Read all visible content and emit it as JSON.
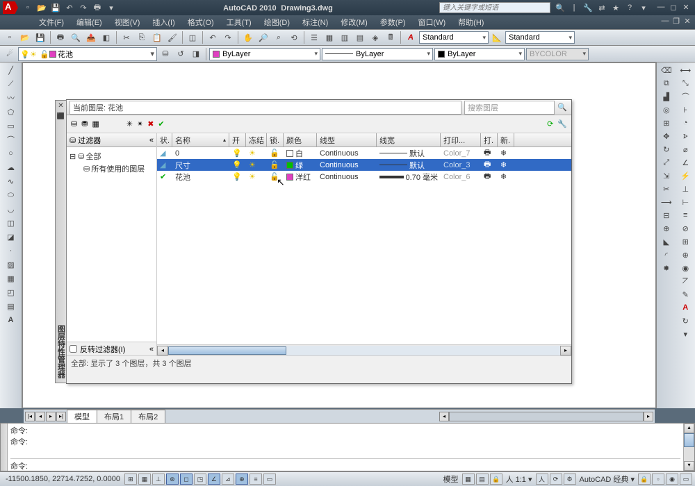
{
  "title": {
    "app": "AutoCAD 2010",
    "file": "Drawing3.dwg",
    "search_placeholder": "键入关键字或短语"
  },
  "menu": [
    "文件(F)",
    "编辑(E)",
    "视图(V)",
    "插入(I)",
    "格式(O)",
    "工具(T)",
    "绘图(D)",
    "标注(N)",
    "修改(M)",
    "参数(P)",
    "窗口(W)",
    "帮助(H)"
  ],
  "styles": {
    "text": "Standard",
    "dim": "Standard"
  },
  "layerbar": {
    "current": "花池",
    "bylayer1": "ByLayer",
    "bylayer2": "ByLayer",
    "bylayer3": "ByLayer",
    "bycolor": "BYCOLOR"
  },
  "layerdlg": {
    "title": "图层特性管理器",
    "current_label": "当前图层: 花池",
    "search_placeholder": "搜索图层",
    "filter_header": "过滤器",
    "tree": {
      "all": "全部",
      "used": "所有使用的图层"
    },
    "invert_filter": "反转过滤器(I)",
    "columns": [
      "状.",
      "名称",
      "开",
      "冻结",
      "锁.",
      "颜色",
      "线型",
      "线宽",
      "打印...",
      "打.",
      "新."
    ],
    "rows": [
      {
        "name": "0",
        "on": true,
        "freeze": false,
        "lock": false,
        "color": "白",
        "swatch": "#ffffff",
        "ltype": "Continuous",
        "lweight": "默认",
        "lw_thick": false,
        "pstyle": "Color_7",
        "sel": false,
        "cur": false
      },
      {
        "name": "尺寸",
        "on": true,
        "freeze": false,
        "lock": false,
        "color": "绿",
        "swatch": "#00c000",
        "ltype": "Continuous",
        "lweight": "默认",
        "lw_thick": false,
        "pstyle": "Color_3",
        "sel": true,
        "cur": false
      },
      {
        "name": "花池",
        "on": true,
        "freeze": false,
        "lock": false,
        "color": "洋红",
        "swatch": "#e040c0",
        "ltype": "Continuous",
        "lweight": "0.70 毫米",
        "lw_thick": true,
        "pstyle": "Color_6",
        "sel": false,
        "cur": true
      }
    ],
    "status": "全部: 显示了 3 个图层，共 3 个图层"
  },
  "tabs": {
    "model": "模型",
    "layout1": "布局1",
    "layout2": "布局2"
  },
  "cmd": {
    "prompt": "命令:",
    "history": [
      "命令:",
      "命令:"
    ]
  },
  "statusbar": {
    "coords": "-11500.1850, 22714.7252, 0.0000",
    "model": "模型",
    "scale": "1:1",
    "workspace": "AutoCAD 经典"
  }
}
